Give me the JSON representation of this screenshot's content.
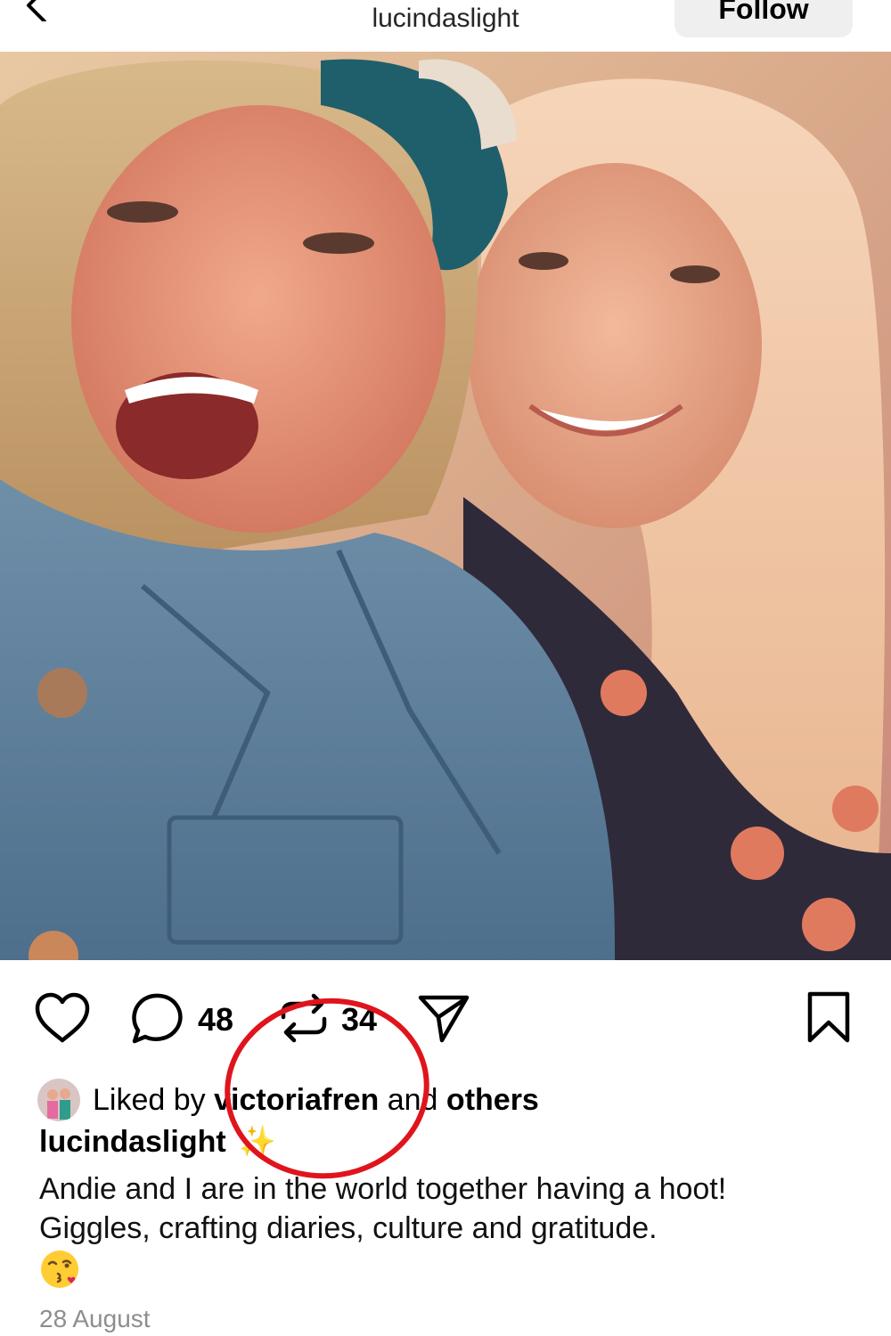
{
  "header": {
    "username": "lucindaslight",
    "follow_label": "Follow"
  },
  "post": {
    "photo_alt": "",
    "actions": {
      "comments_count": "48",
      "reposts_count": "34"
    },
    "liked_by": {
      "prefix": "Liked by",
      "user": "victoriafren",
      "middle": "and",
      "suffix": "others"
    },
    "caption": {
      "username": "lucindaslight",
      "emoji_after_username": "✨",
      "lines": [
        "Andie and I are in the world together having a hoot!",
        "Giggles, crafting diaries, culture and gratitude."
      ],
      "trailing_emoji": "😘"
    },
    "date": "28 August"
  },
  "icons": {
    "back": "chevron-left-icon",
    "like": "heart-icon",
    "comment": "comment-icon",
    "repost": "repost-icon",
    "share": "send-icon",
    "save": "bookmark-icon",
    "caption_emoji": "kiss-emoji-icon"
  },
  "colors": {
    "annotation_circle": "#e0141c",
    "date_text": "#8e8e8e",
    "follow_bg": "#efefef"
  }
}
